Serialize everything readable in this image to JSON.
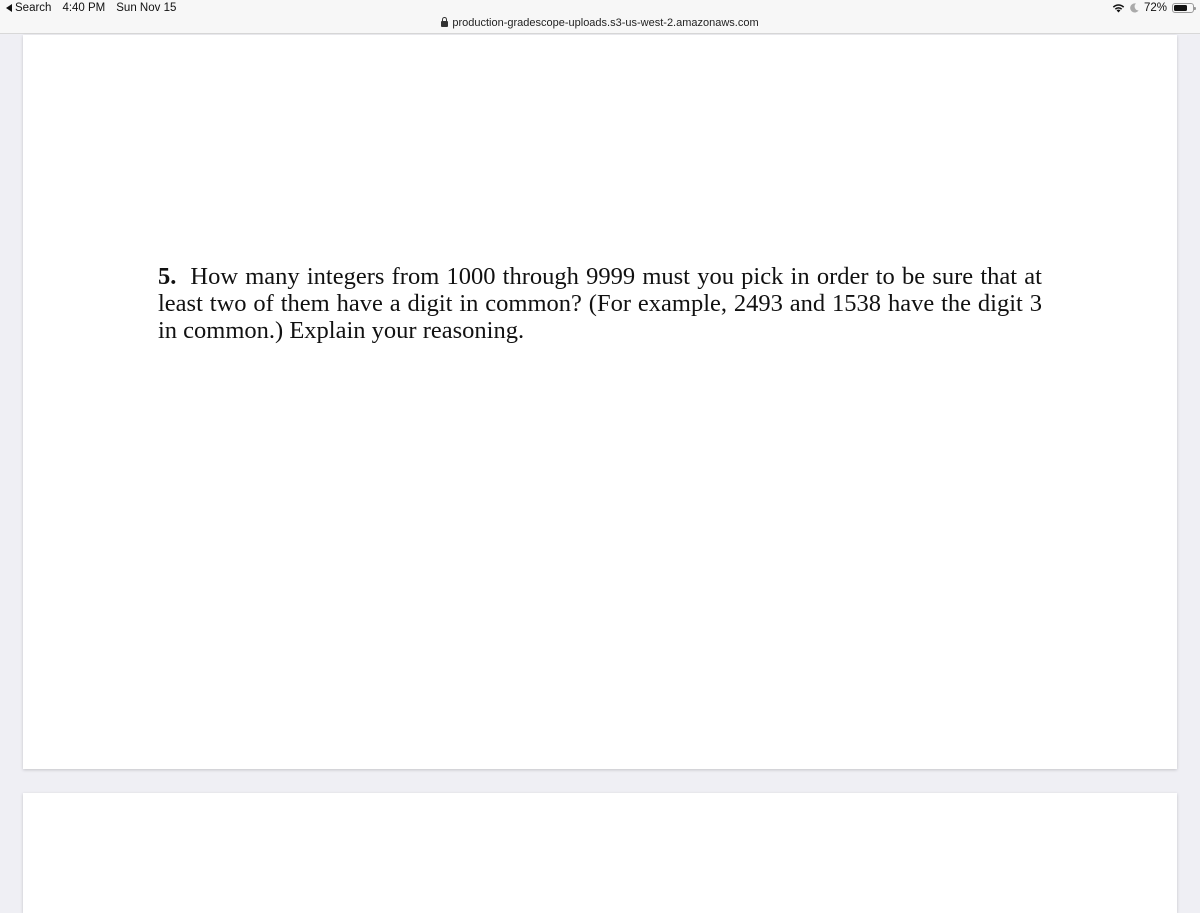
{
  "status_bar": {
    "back_label": "Search",
    "time": "4:40 PM",
    "date": "Sun Nov 15",
    "battery_percent_label": "72%",
    "battery_level": 0.72
  },
  "address_bar": {
    "url": "production-gradescope-uploads.s3-us-west-2.amazonaws.com"
  },
  "document": {
    "question_number": "5.",
    "question_text": "How many integers from 1000 through 9999 must you pick in order to be sure that at least two of them have a digit in common? (For example, 2493 and 1538 have the digit 3 in common.) Explain your reasoning."
  }
}
